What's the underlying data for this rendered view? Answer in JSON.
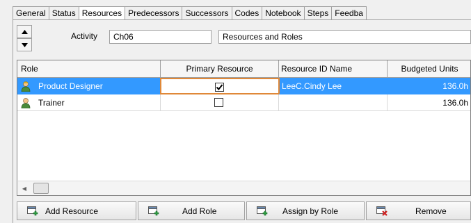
{
  "tabs": [
    "General",
    "Status",
    "Resources",
    "Predecessors",
    "Successors",
    "Codes",
    "Notebook",
    "Steps",
    "Feedba"
  ],
  "active_tab": "Resources",
  "activity": {
    "label": "Activity",
    "id": "Ch06",
    "name": "Resources and Roles"
  },
  "grid": {
    "columns": [
      "Role",
      "Primary Resource",
      "Resource ID Name",
      "Budgeted Units"
    ],
    "rows": [
      {
        "role": "Product Designer",
        "primary": true,
        "resource": "LeeC.Cindy Lee",
        "units": "136.0h",
        "selected": true,
        "icon": "role-selected-icon"
      },
      {
        "role": "Trainer",
        "primary": false,
        "resource": "",
        "units": "136.0h",
        "selected": false,
        "icon": "role-icon"
      }
    ]
  },
  "buttons": {
    "add_resource": "Add Resource",
    "add_role": "Add Role",
    "assign_by_role": "Assign by Role",
    "remove": "Remove"
  },
  "colors": {
    "selection": "#3399ff",
    "focus_border": "#e08838",
    "add_icon_green": "#2ea043",
    "remove_icon_red": "#d02020"
  }
}
